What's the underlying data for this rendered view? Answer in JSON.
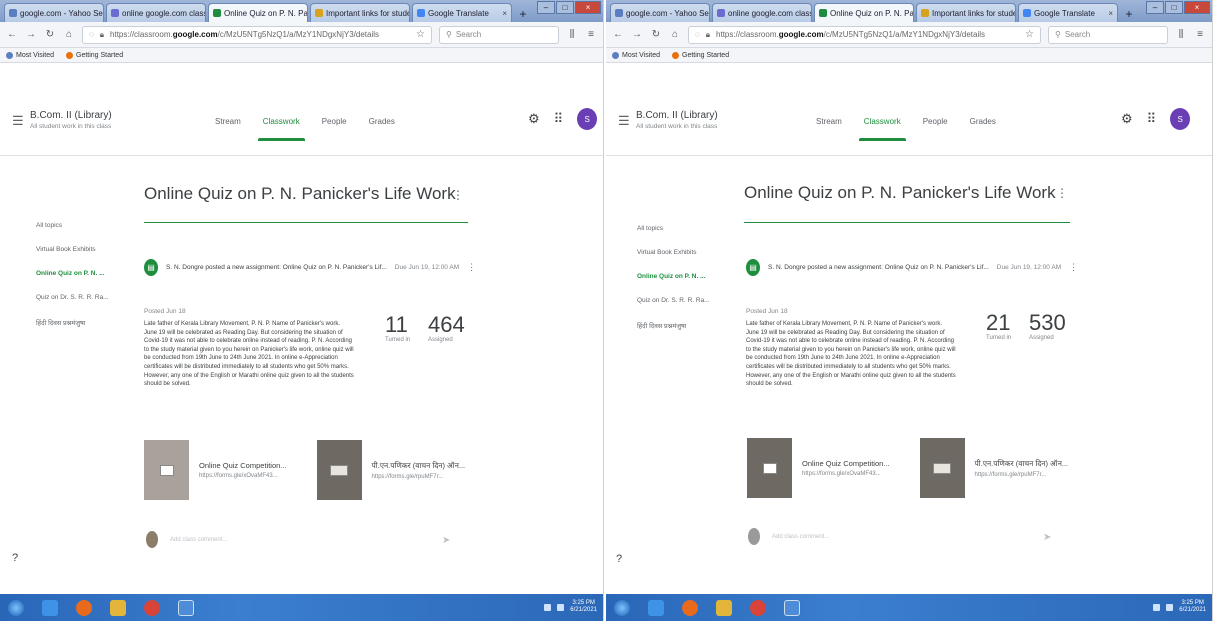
{
  "browser": {
    "tabs": [
      {
        "label": "google.com - Yahoo Search",
        "color": "#5b7ec2"
      },
      {
        "label": "online google.com classroom",
        "color": "#6b6bd0"
      },
      {
        "label": "Online Quiz on P. N. Panicker",
        "color": "#1e8e3e"
      },
      {
        "label": "Important links for students",
        "color": "#d7a21c"
      },
      {
        "label": "Google Translate",
        "color": "#4285f4"
      }
    ],
    "url_prefix": "https://classroom.",
    "url_domain": "google.com",
    "url_path": "/c/MzU5NTg5NzQ1/a/MzY1NDgxNjY3/details",
    "search_placeholder": "Search",
    "bookmarks": [
      {
        "label": "Most Visited",
        "color": "#5b7ec2"
      },
      {
        "label": "Getting Started",
        "color": "#e8710a"
      }
    ]
  },
  "classroom": {
    "class_title": "B.Com. II (Library)",
    "class_subtitle": "All student work in this class",
    "tabs": [
      "Stream",
      "Classwork",
      "People",
      "Grades"
    ],
    "active_tab": "Classwork",
    "avatar_initial": "S"
  },
  "topics": [
    "All topics",
    "Virtual Book Exhibits",
    "Online Quiz on P. N. ...",
    "Quiz on Dr. S. R. R. Ra...",
    "हिंदी दिवस प्रश्नमंजुषा"
  ],
  "assignment": {
    "title": "Online Quiz on P. N. Panicker's Life Work",
    "poster_line": "S. N. Dongre posted a new assignment: Online Quiz on P. N. Panicker's Lif...",
    "post_date": "Due Jun 19, 12:00 AM",
    "posted_on": "Posted Jun 18",
    "body": "Late father of Kerala Library Movement, P. N. P. Name of Panicker's work. June 19 will be celebrated as Reading Day. But considering the situation of Covid-19 it was not able to celebrate online instead of reading. P. N. According to the study material given to you herein on Panicker's life work, online quiz will be conducted from 19th June to 24th June 2021. In online e-Appreciation certificates will be distributed immediately to all students who get 50% marks. However, any one of the English or Marathi online quiz given to all the students should be solved.",
    "turned_in_label": "Turned in",
    "assigned_label": "Assigned",
    "attachments": [
      {
        "title": "Online Quiz Competition...",
        "sub": "https://forms.gle/xOvaMF43..."
      },
      {
        "title": "पी.एन.पणिकर (वाचन दिन) ऑन...",
        "sub": "https://forms.gle/rpuMF7r..."
      }
    ],
    "comment_placeholder": "Add class comment..."
  },
  "snapshots": [
    {
      "turned_in": "11",
      "assigned": "464"
    },
    {
      "turned_in": "21",
      "assigned": "530"
    }
  ],
  "taskbar": {
    "tray_time": "3:25 PM",
    "tray_date": "6/21/2021"
  }
}
